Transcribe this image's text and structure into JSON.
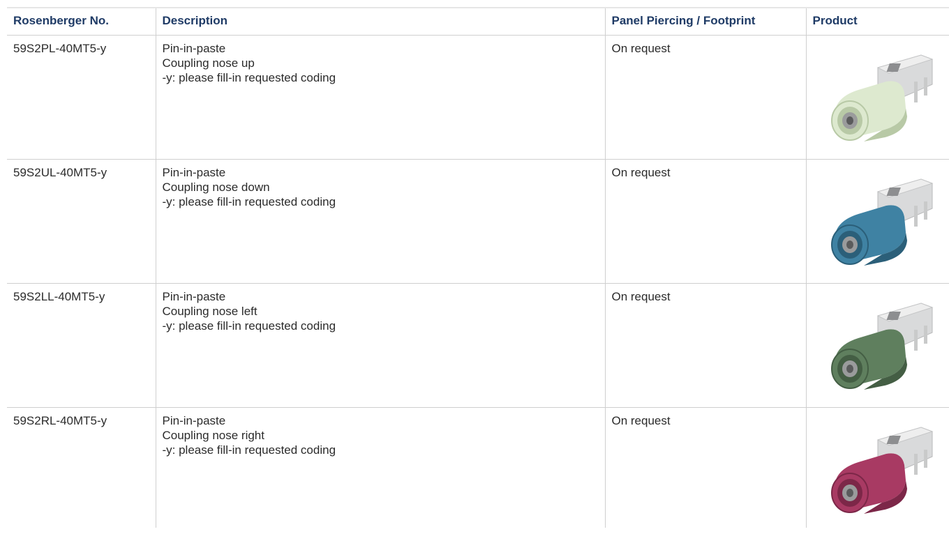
{
  "columns": {
    "part_no": "Rosenberger No.",
    "description": "Description",
    "panel": "Panel Piercing / Footprint",
    "product": "Product"
  },
  "rows": [
    {
      "part_no": "59S2PL-40MT5-y",
      "description": [
        "Pin-in-paste",
        "Coupling nose up",
        "-y: please fill-in requested coding"
      ],
      "panel": "On request",
      "product_image": {
        "icon": "fakra-pcb-connector-icon",
        "housing_color": "#dde9cf",
        "housing_shadow": "#b8c9a6"
      }
    },
    {
      "part_no": "59S2UL-40MT5-y",
      "description": [
        "Pin-in-paste",
        "Coupling nose down",
        "-y: please fill-in requested coding"
      ],
      "panel": "On request",
      "product_image": {
        "icon": "fakra-pcb-connector-icon",
        "housing_color": "#3f82a3",
        "housing_shadow": "#2b5f79"
      }
    },
    {
      "part_no": "59S2LL-40MT5-y",
      "description": [
        "Pin-in-paste",
        "Coupling nose left",
        "-y: please fill-in requested coding"
      ],
      "panel": "On request",
      "product_image": {
        "icon": "fakra-pcb-connector-icon",
        "housing_color": "#5f7f5e",
        "housing_shadow": "#445e44"
      }
    },
    {
      "part_no": "59S2RL-40MT5-y",
      "description": [
        "Pin-in-paste",
        "Coupling nose right",
        "-y: please fill-in requested coding"
      ],
      "panel": "On request",
      "product_image": {
        "icon": "fakra-pcb-connector-icon",
        "housing_color": "#a83a63",
        "housing_shadow": "#7c2748"
      }
    }
  ]
}
